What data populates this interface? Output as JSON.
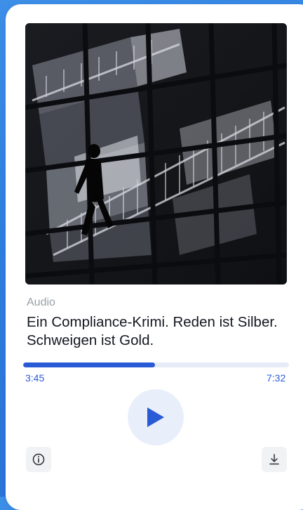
{
  "episode": {
    "kind_label": "Audio",
    "title": "Ein Compliance-Krimi. Reden ist Silber. Schweigen ist Gold.",
    "cover_description": "silhouette-on-staircase-photo"
  },
  "player": {
    "current_time": "3:45",
    "total_time": "7:32",
    "progress": 0.497,
    "play_icon": "play-icon",
    "info_icon": "info-icon",
    "download_icon": "download-icon"
  },
  "colors": {
    "accent": "#2a5bd7",
    "track": "#e6ecf7",
    "play_bg": "#e9effa",
    "muted_text": "#9aa0a6",
    "background": "#2f7fe0"
  }
}
